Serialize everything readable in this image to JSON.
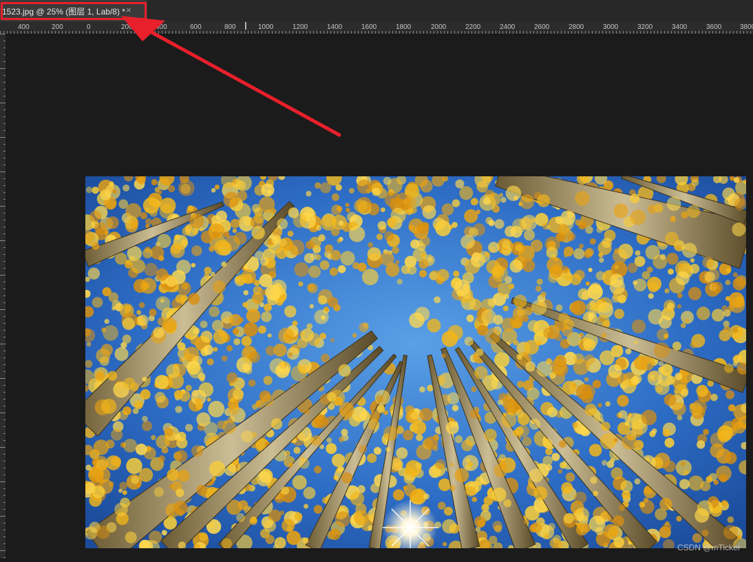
{
  "document_tab": {
    "title": "1523.jpg @ 25% (图层 1, Lab/8) *",
    "close_glyph": "×"
  },
  "ruler": {
    "labels": [
      "400",
      "200",
      "0",
      "200",
      "400",
      "600",
      "800",
      "1000",
      "1200",
      "1400",
      "1600",
      "1800",
      "2000",
      "2200",
      "2400",
      "2600",
      "2800",
      "3000",
      "3200",
      "3400",
      "3600",
      "3800"
    ]
  },
  "canvas": {
    "image_description": "upward view of aspen trees with yellow foliage against blue sky and sunburst"
  },
  "watermark": {
    "text": "CSDN @mTicker"
  },
  "colors": {
    "annotation_red": "#e8202b",
    "workspace": "#1b1b1b",
    "tabbar": "#282828",
    "active_tab": "#3a3a3a"
  }
}
